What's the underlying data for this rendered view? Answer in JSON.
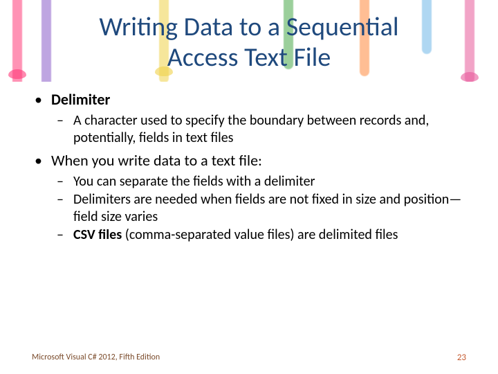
{
  "title_line1": "Writing Data to a Sequential",
  "title_line2": "Access Text File",
  "bullets": {
    "b1_label": "Delimiter",
    "b1_sub1": "A character used to specify the boundary between records and, potentially, fields in text files",
    "b2_label": "When you write data to a text file:",
    "b2_sub1": "You can separate the fields with a delimiter",
    "b2_sub2": "Delimiters are needed when fields are not fixed in size and position—field size varies",
    "b2_sub3_strong": "CSV files",
    "b2_sub3_rest": " (comma-separated value files) are delimited files"
  },
  "footer_left": "Microsoft Visual C# 2012, Fifth Edition",
  "footer_right": "23"
}
